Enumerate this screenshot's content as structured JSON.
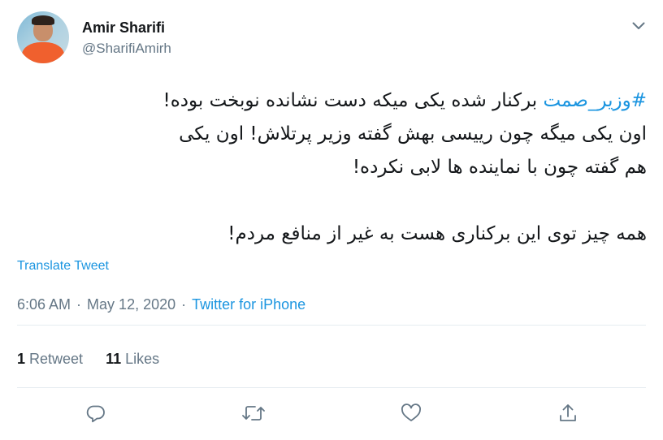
{
  "author": {
    "display_name": "Amir Sharifi",
    "handle": "@SharifiAmirh"
  },
  "tweet": {
    "hashtag": "#وزیر_صمت",
    "line1_rest": " برکنار شده یکی میکه دست نشانده نوبخت بوده!",
    "line2": "اون یکی میگه چون رییسی بهش گفته وزیر پرتلاش! اون یکی",
    "line3": "هم گفته چون با نماینده ها لابی نکرده!",
    "line4": "همه چیز توی این برکناری هست به غیر از منافع مردم!"
  },
  "translate_label": "Translate Tweet",
  "meta": {
    "time": "6:06 AM",
    "separator": "·",
    "date": "May 12, 2020",
    "source": "Twitter for iPhone"
  },
  "stats": {
    "retweets_count": "1",
    "retweets_label": "Retweet",
    "likes_count": "11",
    "likes_label": "Likes"
  },
  "icons": {
    "more": "chevron-down-icon",
    "reply": "reply-icon",
    "retweet": "retweet-icon",
    "like": "heart-icon",
    "share": "share-icon"
  },
  "colors": {
    "link": "#1b95e0",
    "secondary_text": "#657786",
    "primary_text": "#14171a",
    "divider": "#e6ecf0"
  }
}
